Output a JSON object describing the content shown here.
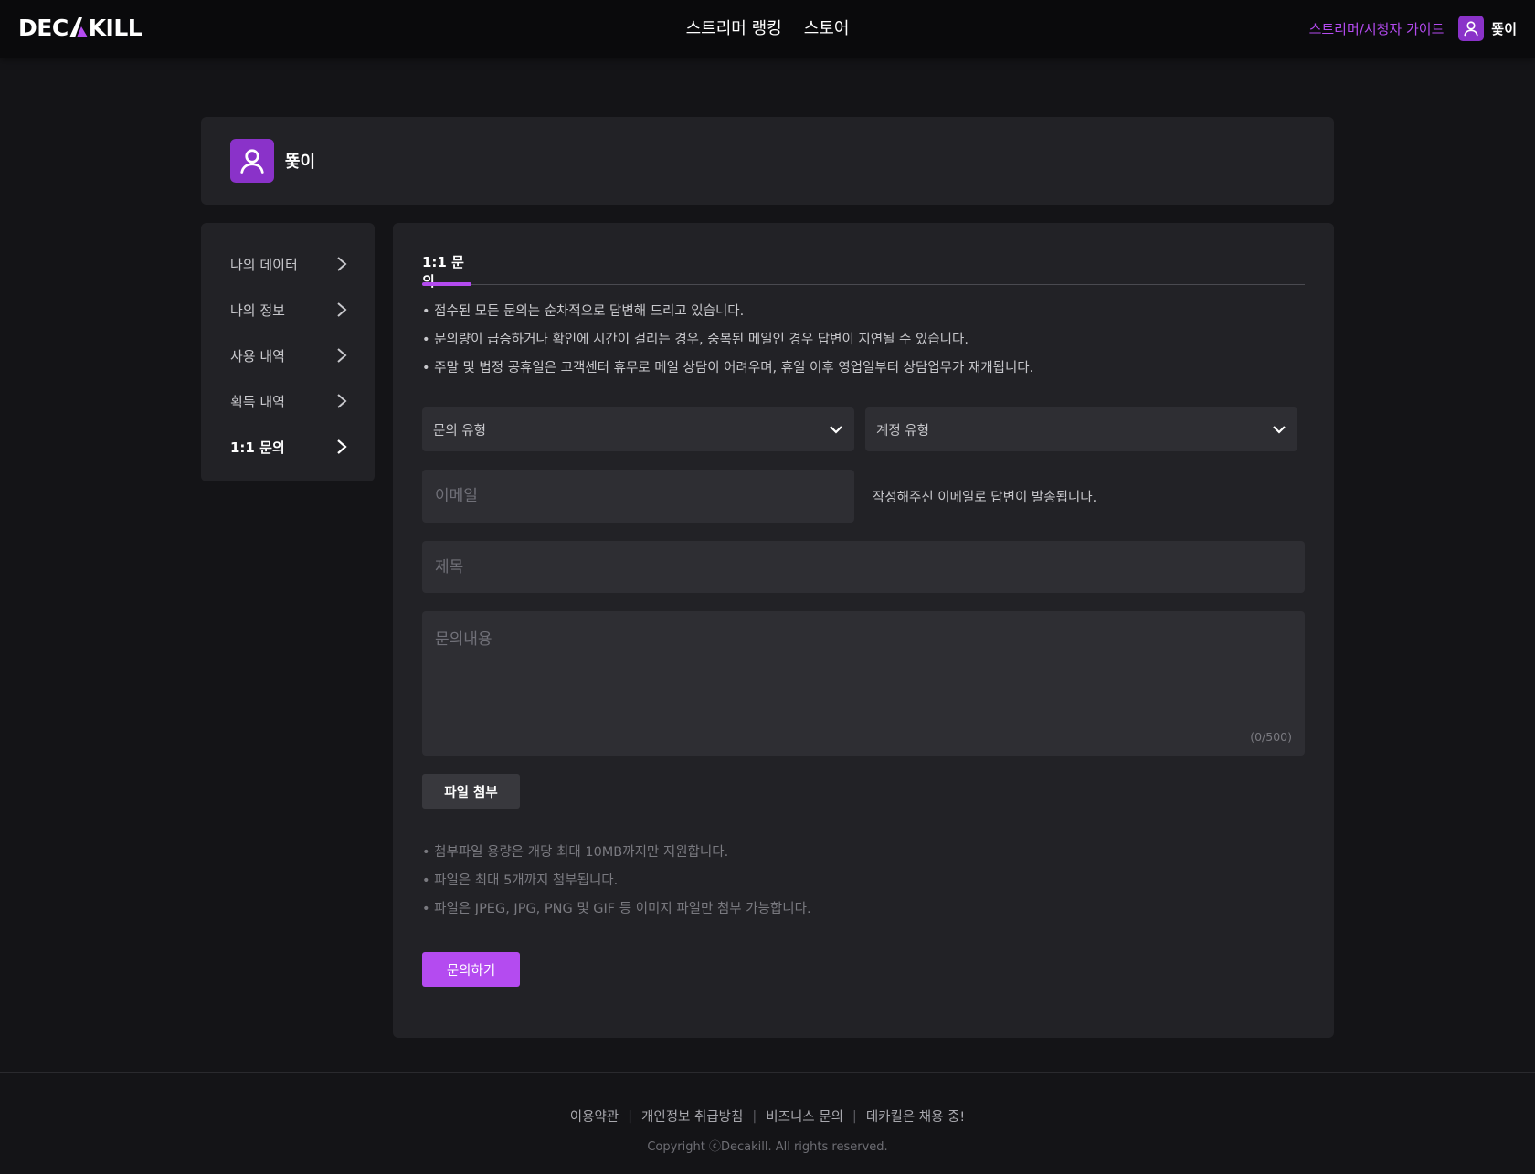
{
  "header": {
    "logo_text_left": "DEC",
    "logo_text_right": "KILL",
    "nav": [
      {
        "label": "스트리머 랭킹"
      },
      {
        "label": "스토어"
      }
    ],
    "guide_link": "스트리머/시청자 가이드",
    "username": "뚗이"
  },
  "profile": {
    "name": "뚗이"
  },
  "sidebar": {
    "items": [
      {
        "label": "나의 데이터"
      },
      {
        "label": "나의 정보"
      },
      {
        "label": "사용 내역"
      },
      {
        "label": "획득 내역"
      },
      {
        "label": "1:1 문의"
      }
    ],
    "active_index": 4
  },
  "inquiry": {
    "tab_label": "1:1 문의",
    "notices": [
      "• 접수된 모든 문의는 순차적으로 답변해 드리고 있습니다.",
      "• 문의량이 급증하거나 확인에 시간이 걸리는 경우, 중복된 메일인 경우 답변이 지연될 수 있습니다.",
      "• 주말 및 법정 공휴일은 고객센터 휴무로 메일 상담이 어려우며, 휴일 이후 영업일부터 상담업무가 재개됩니다."
    ],
    "inquiry_type": {
      "value": "문의 유형"
    },
    "account_type": {
      "value": "계정 유형"
    },
    "email": {
      "placeholder": "이메일",
      "value": ""
    },
    "email_hint": "작성해주신 이메일로 답변이 발송됩니다.",
    "title": {
      "placeholder": "제목",
      "value": ""
    },
    "body": {
      "placeholder": "문의내용",
      "value": ""
    },
    "counter": "(0/500)",
    "attach_button": "파일 첨부",
    "file_notices": [
      "• 첨부파일 용량은 개당 최대 10MB까지만 지원합니다.",
      "• 파일은 최대 5개까지 첨부됩니다.",
      "• 파일은 JPEG, JPG, PNG 및 GIF 등 이미지 파일만 첨부 가능합니다."
    ],
    "submit_button": "문의하기"
  },
  "footer": {
    "links": [
      {
        "label": "이용약관"
      },
      {
        "label": "개인정보 취급방침"
      },
      {
        "label": "비즈니스 문의"
      },
      {
        "label": "데카킬은 채용 중!"
      }
    ],
    "separator": "|",
    "copyright": "Copyright ⓒDecakill. All rights reserved."
  },
  "colors": {
    "accent": "#b44bf0",
    "avatar_bg": "#8a32c9",
    "page_bg": "#141417",
    "panel_bg": "#222226",
    "field_bg": "#2e2e33"
  }
}
